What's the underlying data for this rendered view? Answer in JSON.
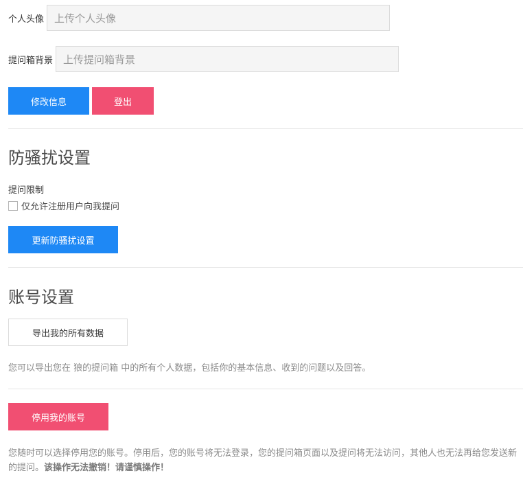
{
  "profile": {
    "avatar_label": "个人头像",
    "avatar_placeholder": "上传个人头像",
    "background_label": "提问箱背景",
    "background_placeholder": "上传提问箱背景",
    "edit_button": "修改信息",
    "logout_button": "登出"
  },
  "anti_harass": {
    "title": "防骚扰设置",
    "limit_label": "提问限制",
    "checkbox_label": "仅允许注册用户向我提问",
    "checkbox_checked": false,
    "update_button": "更新防骚扰设置"
  },
  "account": {
    "title": "账号设置",
    "export_button": "导出我的所有数据",
    "export_help": "您可以导出您在 狼的提问箱 中的所有个人数据，包括你的基本信息、收到的问题以及回答。",
    "deactivate_button": "停用我的账号",
    "deactivate_help": "您随时可以选择停用您的账号。停用后，您的账号将无法登录，您的提问箱页面以及提问将无法访问，其他人也无法再给您发送新的提问。",
    "deactivate_warning": "该操作无法撤销！请谨慎操作！"
  },
  "colors": {
    "primary": "#1e88f5",
    "danger": "#f14f72"
  }
}
